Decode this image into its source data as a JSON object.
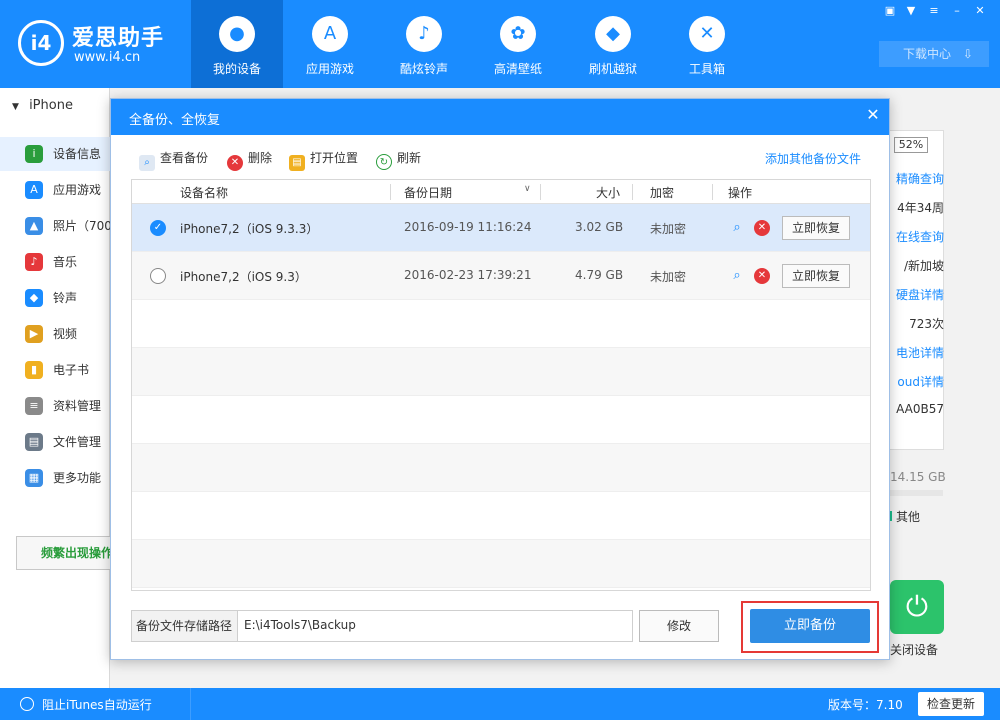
{
  "app": {
    "brand_name": "爱思助手",
    "brand_url": "www.i4.cn",
    "logo_text": "i4"
  },
  "nav": [
    {
      "label": "我的设备",
      "icon": "apple-icon",
      "glyph": ""
    },
    {
      "label": "应用游戏",
      "icon": "app-store-icon",
      "glyph": "A"
    },
    {
      "label": "酷炫铃声",
      "icon": "bell-icon",
      "glyph": "♪"
    },
    {
      "label": "高清壁纸",
      "icon": "flower-icon",
      "glyph": "✿"
    },
    {
      "label": "刷机越狱",
      "icon": "dropbox-icon",
      "glyph": "◆"
    },
    {
      "label": "工具箱",
      "icon": "tools-icon",
      "glyph": "✕"
    }
  ],
  "header": {
    "download_center": "下载中心"
  },
  "sidebar": {
    "device": "iPhone",
    "items": [
      {
        "label": "设备信息",
        "icon": "info-icon",
        "color": "#2a9d3c",
        "glyph": "i"
      },
      {
        "label": "应用游戏",
        "icon": "app-store-icon",
        "color": "#1a8cff",
        "glyph": "A"
      },
      {
        "label": "照片（700",
        "icon": "photo-icon",
        "color": "#3a8ee6",
        "glyph": "▲"
      },
      {
        "label": "音乐",
        "icon": "music-icon",
        "color": "#e5383b",
        "glyph": "♪"
      },
      {
        "label": "铃声",
        "icon": "bell-icon",
        "color": "#1a8cff",
        "glyph": "◆"
      },
      {
        "label": "视频",
        "icon": "video-icon",
        "color": "#e0a020",
        "glyph": "▶"
      },
      {
        "label": "电子书",
        "icon": "book-icon",
        "color": "#f0b020",
        "glyph": "▮"
      },
      {
        "label": "资料管理",
        "icon": "contacts-icon",
        "color": "#8a8a8a",
        "glyph": "≡"
      },
      {
        "label": "文件管理",
        "icon": "folder-icon",
        "color": "#6c7a89",
        "glyph": "▤"
      },
      {
        "label": "更多功能",
        "icon": "grid-icon",
        "color": "#3a8ee6",
        "glyph": "▦"
      }
    ],
    "frequent_issue": "频繁出现操作"
  },
  "right_panel": {
    "battery": "52%",
    "lines": [
      "精确查询",
      "4年34周",
      "在线查询",
      "/新加坡",
      "硬盘详情",
      "723次",
      "电池详情",
      "oud详情",
      "AA0B57"
    ],
    "storage": "14.15 GB",
    "legend_other": "其他",
    "shutdown_label": "关闭设备"
  },
  "dialog": {
    "title": "全备份、全恢复",
    "toolbar": {
      "view": "查看备份",
      "delete": "删除",
      "open": "打开位置",
      "refresh": "刷新",
      "add_other": "添加其他备份文件"
    },
    "columns": {
      "name": "设备名称",
      "date": "备份日期",
      "size": "大小",
      "encrypt": "加密",
      "ops": "操作"
    },
    "rows": [
      {
        "name": "iPhone7,2（iOS 9.3.3）",
        "date": "2016-09-19 11:16:24",
        "size": "3.02 GB",
        "encrypt": "未加密",
        "restore": "立即恢复",
        "selected": true
      },
      {
        "name": "iPhone7,2（iOS 9.3）",
        "date": "2016-02-23 17:39:21",
        "size": "4.79 GB",
        "encrypt": "未加密",
        "restore": "立即恢复",
        "selected": false
      }
    ],
    "path_label": "备份文件存储路径",
    "path_value": "E:\\i4Tools7\\Backup",
    "modify": "修改",
    "backup_now": "立即备份"
  },
  "statusbar": {
    "itunes_block": "阻止iTunes自动运行",
    "version": "版本号：7.10",
    "check_update": "检查更新"
  },
  "colors": {
    "primary": "#1a8cff",
    "selected_row": "#dbe9fb",
    "highlight_border": "#e53935",
    "delete_red": "#e5383b"
  }
}
